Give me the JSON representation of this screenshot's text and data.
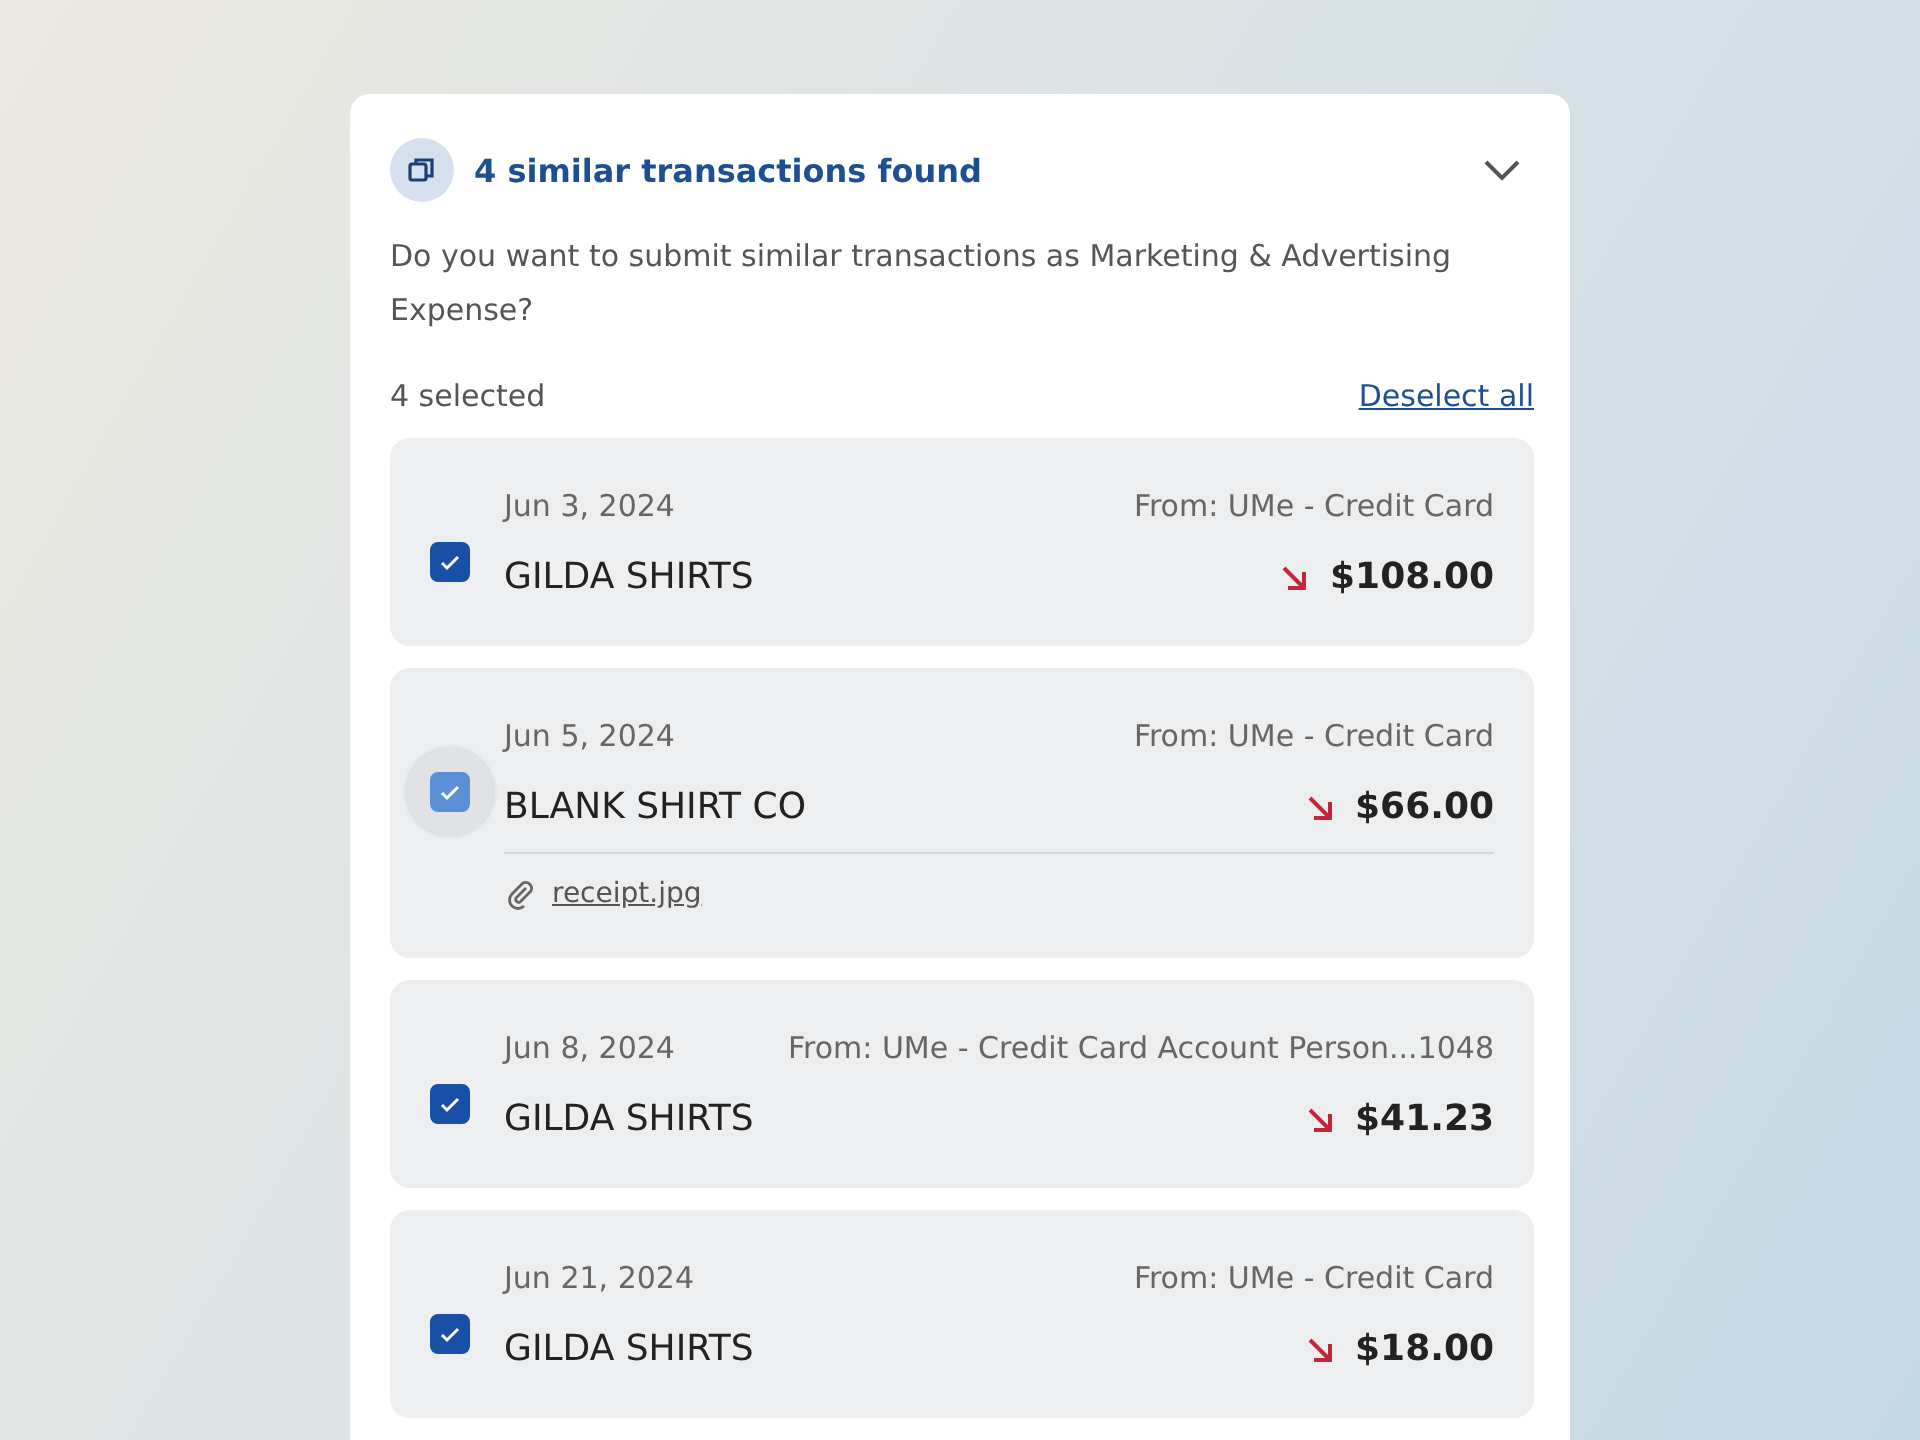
{
  "panel": {
    "title": "4 similar transactions found",
    "expanded": true,
    "question": "Do you want to submit similar transactions as Marketing & Advertising Expense?",
    "selected_count": "4 selected",
    "deselect_link": "Deselect all"
  },
  "transactions": [
    {
      "date": "Jun 3, 2024",
      "source": "From: UMe - Credit Card",
      "merchant": "GILDA SHIRTS",
      "amount": "$108.00",
      "checked": true,
      "focused": false
    },
    {
      "date": "Jun 5, 2024",
      "source": "From: UMe - Credit Card",
      "merchant": "BLANK SHIRT CO",
      "amount": "$66.00",
      "checked": true,
      "focused": true,
      "attachment": "receipt.jpg"
    },
    {
      "date": "Jun 8, 2024",
      "source": "From: UMe - Credit Card Account Person...1048",
      "merchant": "GILDA SHIRTS",
      "amount": "$41.23",
      "checked": true,
      "focused": false
    },
    {
      "date": "Jun 21, 2024",
      "source": "From: UMe - Credit Card",
      "merchant": "GILDA SHIRTS",
      "amount": "$18.00",
      "checked": true,
      "focused": false
    }
  ]
}
